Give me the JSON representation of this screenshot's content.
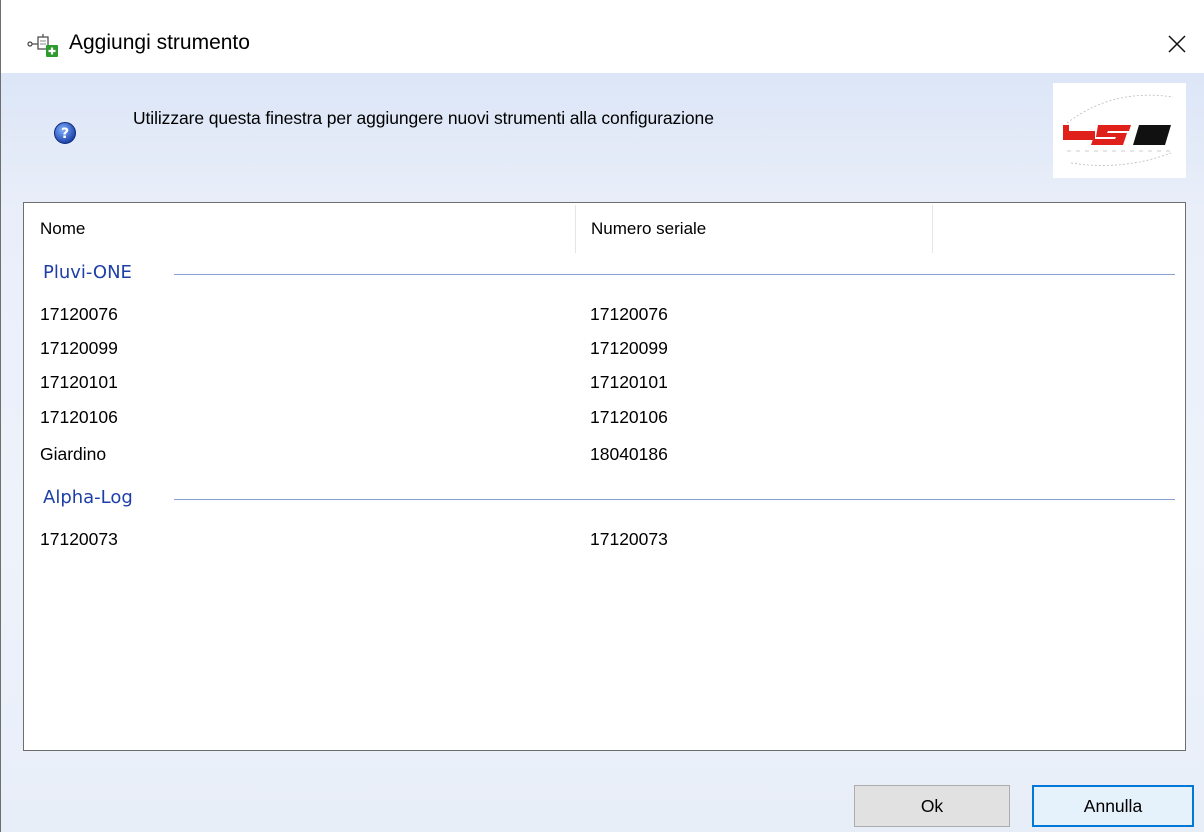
{
  "window": {
    "title": "Aggiungi strumento",
    "title_icon": "add-instrument-icon",
    "close_icon": "close-icon"
  },
  "info": {
    "icon": "help-icon",
    "text": "Utilizzare questa finestra per aggiungere nuovi strumenti alla configurazione",
    "logo_text": "LSI"
  },
  "list": {
    "columns": [
      "Nome",
      "Numero seriale"
    ],
    "groups": [
      {
        "name": "Pluvi-ONE",
        "rows": [
          {
            "nome": "17120076",
            "seriale": "17120076"
          },
          {
            "nome": "17120099",
            "seriale": "17120099"
          },
          {
            "nome": "17120101",
            "seriale": "17120101"
          },
          {
            "nome": "17120106",
            "seriale": "17120106"
          },
          {
            "nome": "Giardino",
            "seriale": "18040186"
          }
        ]
      },
      {
        "name": "Alpha-Log",
        "rows": [
          {
            "nome": "17120073",
            "seriale": "17120073"
          }
        ]
      }
    ]
  },
  "buttons": {
    "ok": "Ok",
    "cancel": "Annulla"
  },
  "colors": {
    "group_text": "#1e3fa8",
    "group_line": "#8aa0d2",
    "default_button_border": "#0078d7",
    "logo_red": "#e0201a",
    "logo_dark": "#111111"
  }
}
